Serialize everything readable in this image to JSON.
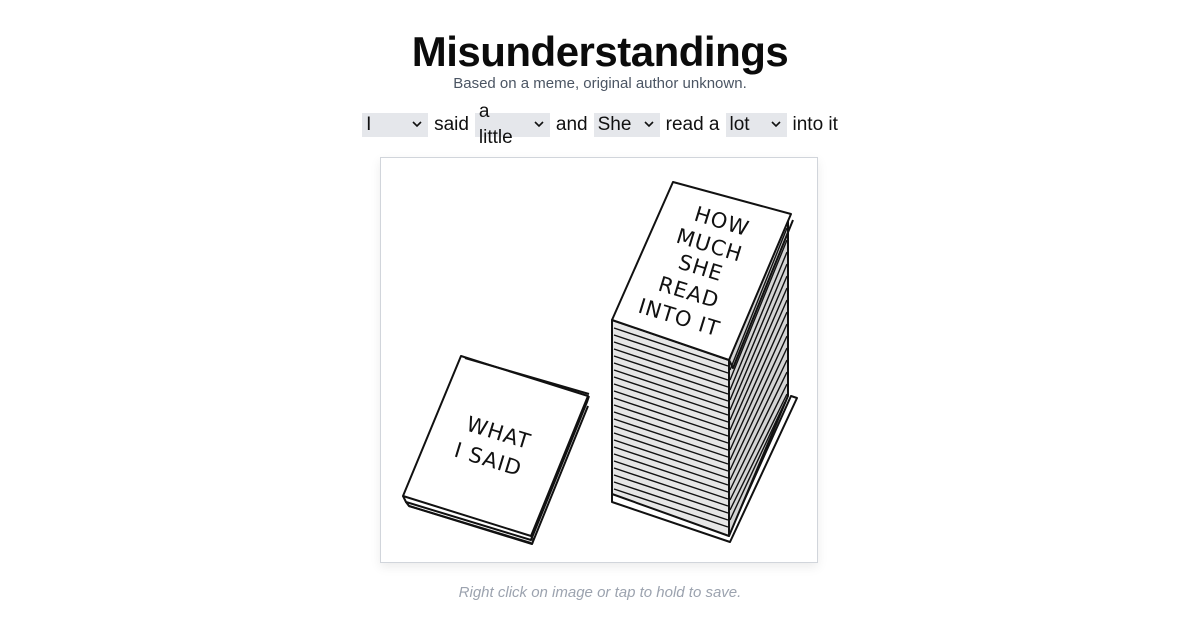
{
  "header": {
    "title": "Misunderstandings",
    "subtitle": "Based on a meme, original author unknown."
  },
  "sentence": {
    "subject": "I",
    "word_said": "said",
    "amount": "a little",
    "word_and": "and",
    "who": "She",
    "word_read": "read a",
    "much": "lot",
    "word_into": "into it"
  },
  "illustration": {
    "left_sheet_text": [
      "WHAT",
      "I SAID"
    ],
    "stack_text": [
      "HOW",
      "MUCH",
      "SHE",
      "READ",
      "INTO IT"
    ]
  },
  "footer": {
    "caption": "Right click on image or tap to hold to save."
  }
}
